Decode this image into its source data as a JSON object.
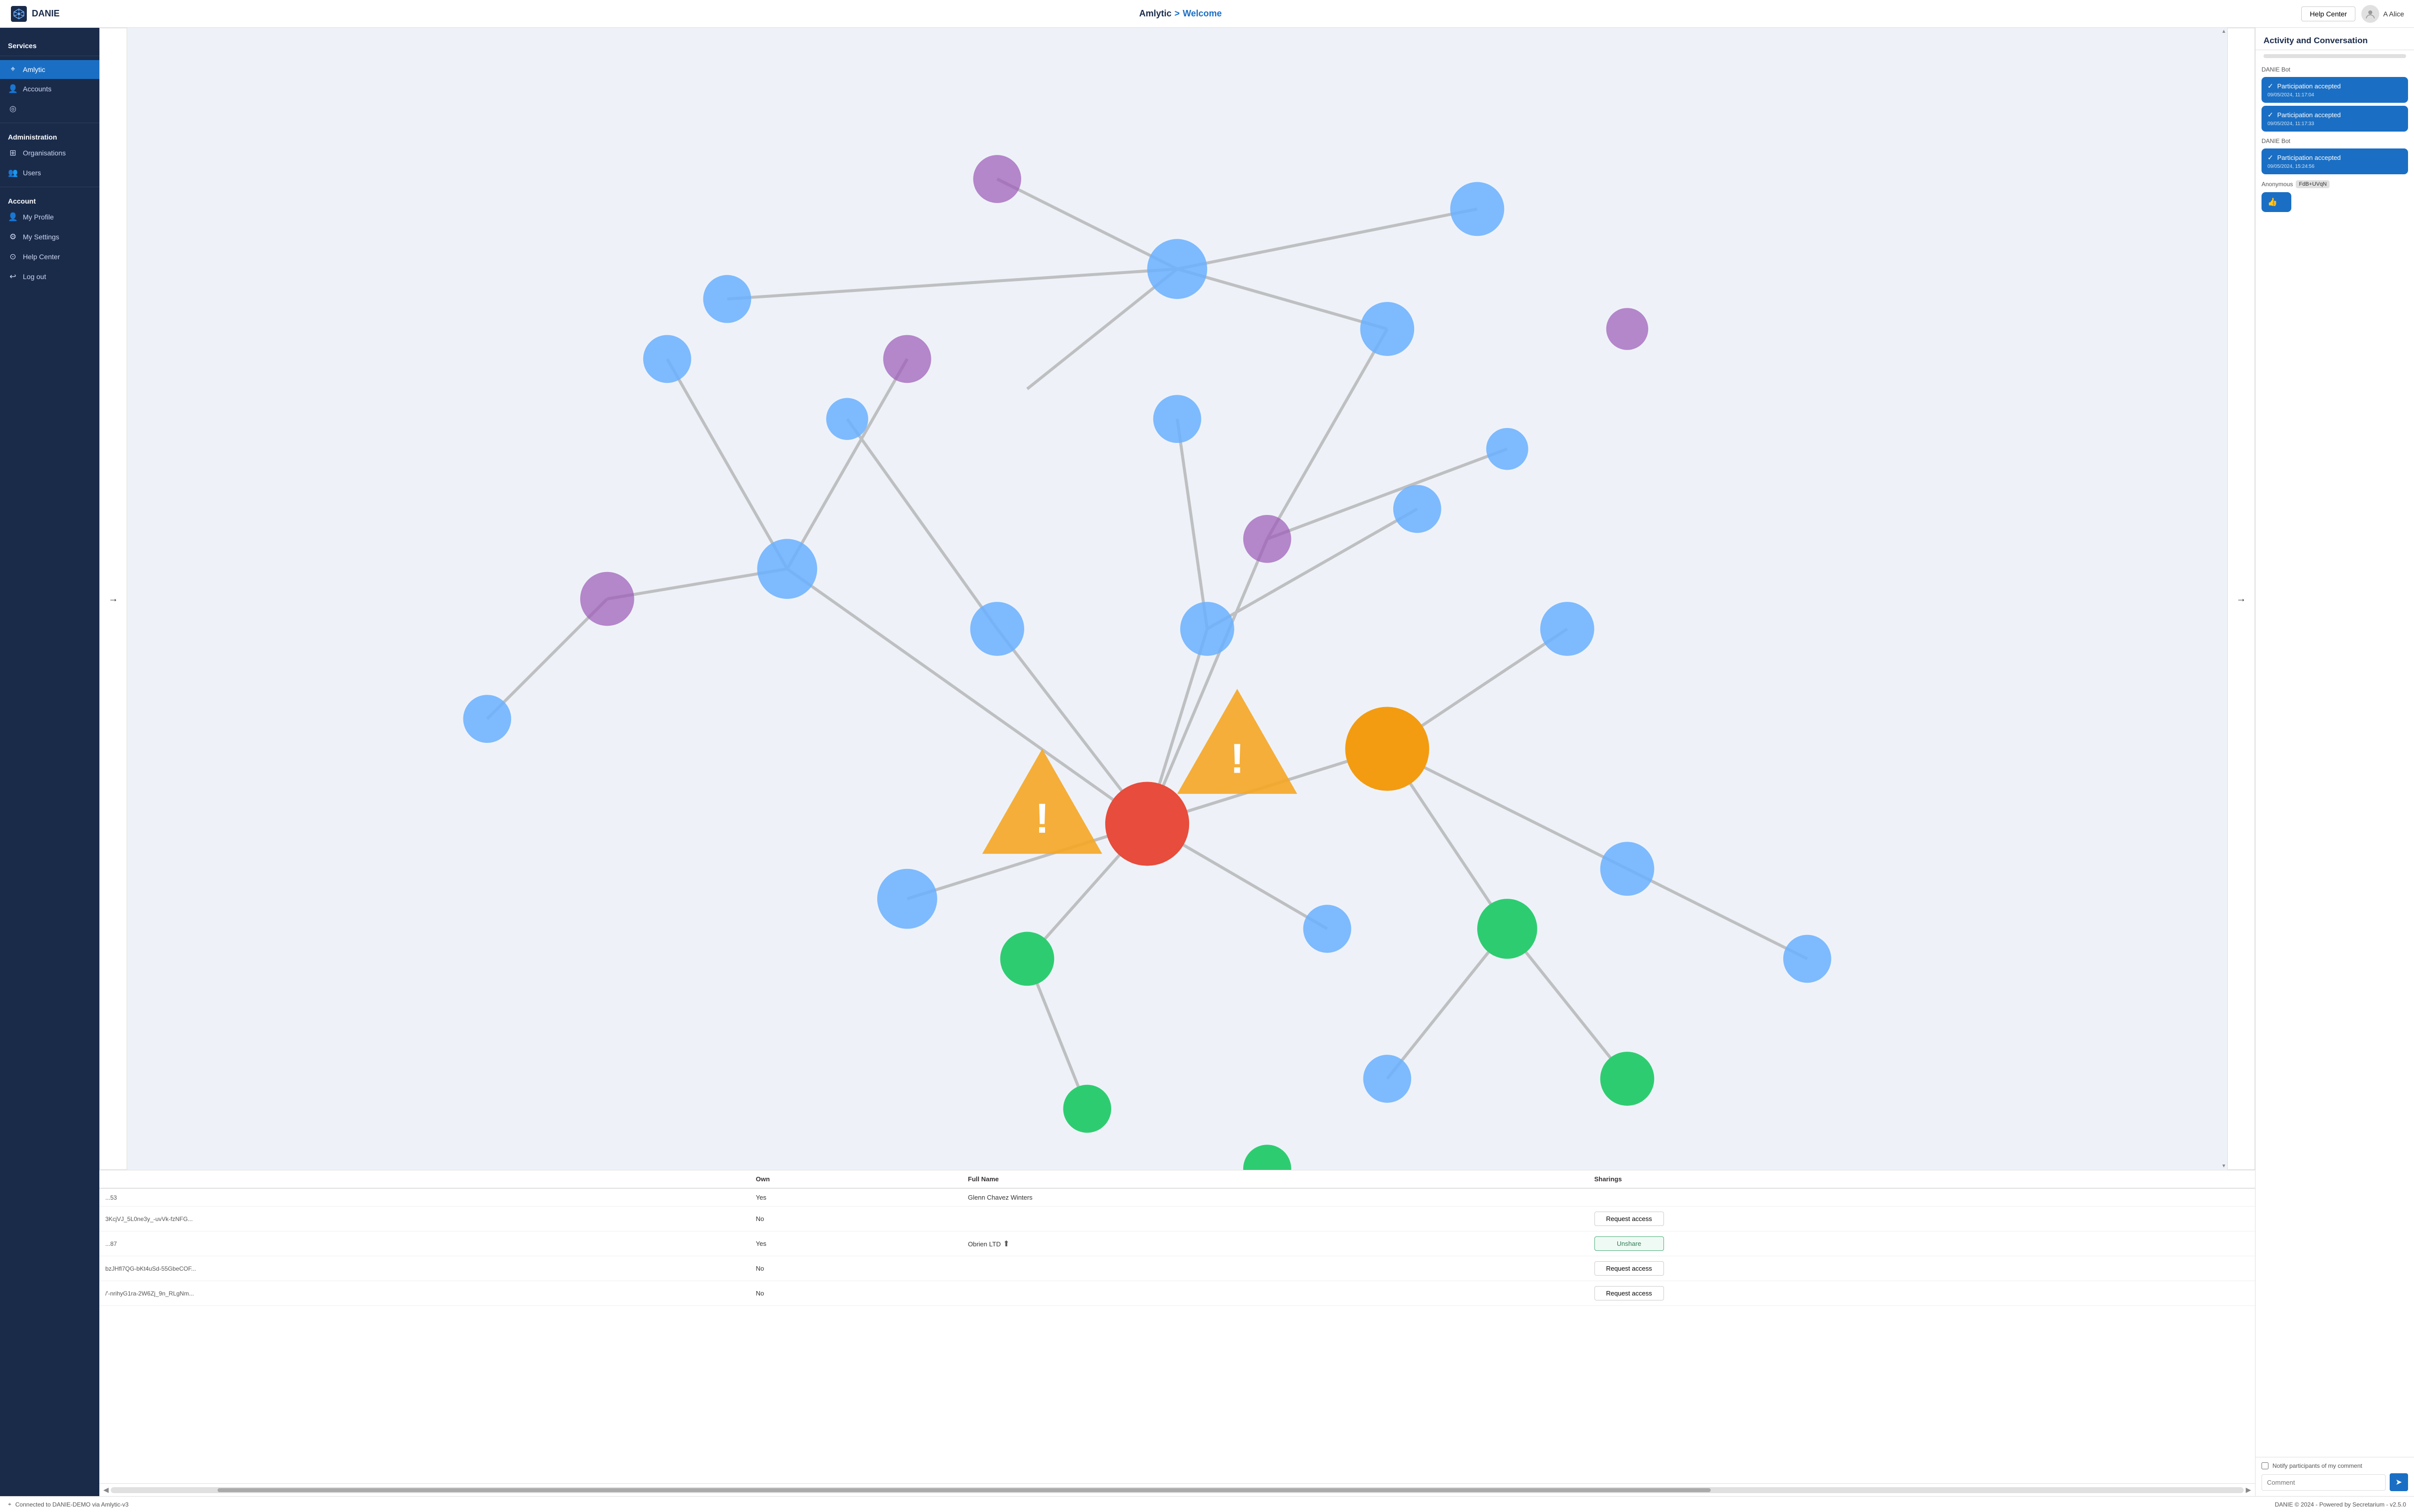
{
  "app": {
    "name": "DANIE",
    "version": "v2.5.0"
  },
  "header": {
    "breadcrumb_current": "Amlytic",
    "breadcrumb_sep": ">",
    "breadcrumb_page": "Welcome",
    "help_center_label": "Help Center",
    "user_name": "A Alice"
  },
  "sidebar": {
    "services_label": "Services",
    "amlytic_label": "Amlytic",
    "accounts_label": "Accounts",
    "geo_label": "",
    "administration_label": "Administration",
    "organisations_label": "Organisations",
    "users_label": "Users",
    "account_label": "Account",
    "my_profile_label": "My Profile",
    "my_settings_label": "My Settings",
    "help_center_label": "Help Center",
    "log_out_label": "Log out"
  },
  "table": {
    "columns": [
      "Own",
      "Full Name",
      "Sharings"
    ],
    "rows": [
      {
        "id": "...53",
        "own": "Yes",
        "full_name": "Glenn Chavez Winters",
        "sharing": "none"
      },
      {
        "id": "3KcjVJ_5L0ne3y_-uvVk-fzNFG...",
        "own": "No",
        "full_name": "",
        "sharing": "request"
      },
      {
        "id": "...87",
        "own": "Yes",
        "full_name": "Obrien LTD",
        "sharing": "unshare"
      },
      {
        "id": "bzJHfl7QG-bKt4uSd-55GbeCOF...",
        "own": "No",
        "full_name": "",
        "sharing": "request"
      },
      {
        "id": "/'-nrihyG1ra-2W6Zj_9n_RLgNm...",
        "own": "No",
        "full_name": "",
        "sharing": "request"
      }
    ],
    "request_label": "Request access",
    "unshare_label": "Unshare"
  },
  "activity": {
    "title": "Activity and Conversation",
    "messages": [
      {
        "sender": "DANIE Bot",
        "bubbles": [
          {
            "text": "Participation accepted",
            "timestamp": "09/05/2024, 11:17:04"
          },
          {
            "text": "Participation accepted",
            "timestamp": "09/05/2024, 11:17:33"
          }
        ]
      },
      {
        "sender": "DANIE Bot",
        "bubbles": [
          {
            "text": "Participation accepted",
            "timestamp": "09/05/2024, 15:24:56"
          }
        ]
      },
      {
        "sender": "Anonymous",
        "badge": "FdB+UVqN",
        "bubbles": [
          {
            "text": "👍",
            "timestamp": ""
          }
        ]
      }
    ],
    "notify_label": "Notify participants of my comment",
    "comment_placeholder": "Comment",
    "send_icon": "➤"
  },
  "footer": {
    "connection_label": "Connected to DANIE-DEMO via Amlytic-v3",
    "copyright": "DANIE © 2024 - Powered by Secretarium - v2.5.0"
  }
}
